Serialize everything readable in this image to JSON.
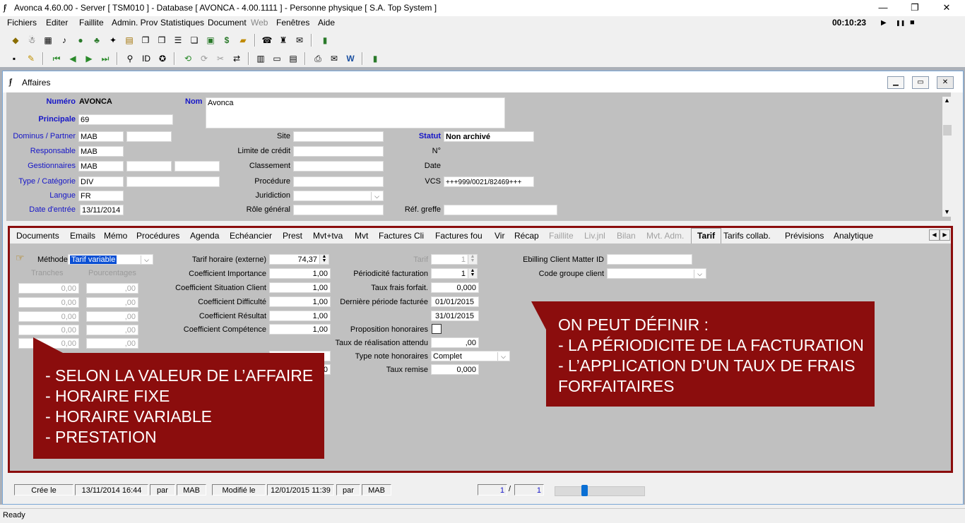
{
  "window": {
    "title": "Avonca 4.60.00 - Server [ TSM010 ] - Database [ AVONCA - 4.00.1111 ] - Personne physique [ S.A. Top System ]",
    "minimize": "—",
    "restore": "❐",
    "close": "✕"
  },
  "menu": [
    "Fichiers",
    "Editer",
    "Faillite",
    "Admin. Prov",
    "Statistiques",
    "Document",
    "Web",
    "Fenêtres",
    "Aide"
  ],
  "timer": {
    "value": "00:10:23",
    "play": "▶",
    "pause": "❚❚",
    "stop": "■"
  },
  "child": {
    "title": "Affaires",
    "min": "▁",
    "max": "▭",
    "close": "✕"
  },
  "fields": {
    "numero_label": "Numéro",
    "numero": "AVONCA",
    "nom_label": "Nom",
    "nom": "Avonca",
    "principale_label": "Principale",
    "principale": "69",
    "dominus_label": "Dominus / Partner",
    "dominus": "MAB",
    "responsable_label": "Responsable",
    "responsable": "MAB",
    "gestionnaires_label": "Gestionnaires",
    "gestionnaires": "MAB",
    "type_label": "Type / Catégorie",
    "type": "DIV",
    "langue_label": "Langue",
    "langue": "FR",
    "date_entree_label": "Date d'entrée",
    "date_entree": "13/11/2014",
    "site_label": "Site",
    "limite_label": "Limite de crédit",
    "classement_label": "Classement",
    "procedure_label": "Procédure",
    "juridiction_label": "Juridiction",
    "role_label": "Rôle général",
    "statut_label": "Statut",
    "statut": "Non archivé",
    "no_label": "N°",
    "date_label": "Date",
    "vcs_label": "VCS",
    "vcs": "+++999/0021/82469+++",
    "ref_label": "Réf. greffe"
  },
  "tabs": [
    {
      "label": "Documents",
      "state": "normal"
    },
    {
      "label": "Emails",
      "state": "normal"
    },
    {
      "label": "Mémo",
      "state": "normal"
    },
    {
      "label": "Procédures",
      "state": "normal"
    },
    {
      "label": "Agenda",
      "state": "normal"
    },
    {
      "label": "Echéancier",
      "state": "normal"
    },
    {
      "label": "Prest",
      "state": "normal"
    },
    {
      "label": "Mvt+tva",
      "state": "normal"
    },
    {
      "label": "Mvt",
      "state": "normal"
    },
    {
      "label": "Factures Cli",
      "state": "normal"
    },
    {
      "label": "Factures fou",
      "state": "normal"
    },
    {
      "label": "Vir",
      "state": "normal"
    },
    {
      "label": "Récap",
      "state": "normal"
    },
    {
      "label": "Faillite",
      "state": "disabled"
    },
    {
      "label": "Liv.jnl",
      "state": "disabled"
    },
    {
      "label": "Bilan",
      "state": "disabled"
    },
    {
      "label": "Mvt. Adm.",
      "state": "disabled"
    },
    {
      "label": "Tarif",
      "state": "active"
    },
    {
      "label": "Tarifs collab.",
      "state": "normal"
    },
    {
      "label": "Prévisions",
      "state": "normal"
    },
    {
      "label": "Analytique",
      "state": "normal"
    }
  ],
  "tarif": {
    "methode_label": "Méthode",
    "methode": "Tarif variable",
    "tranches_label": "Tranches",
    "pourcentages_label": "Pourcentages",
    "zero_val": "0,00",
    "zero_pct": ",00",
    "tarif_horaire_label": "Tarif horaire (externe)",
    "tarif_horaire": "74,37",
    "coef_importance_label": "Coefficient Importance",
    "coef_importance": "1,00",
    "coef_situation_label": "Coefficient Situation Client",
    "coef_situation": "1,00",
    "coef_difficulte_label": "Coefficient Difficulté",
    "coef_difficulte": "1,00",
    "coef_resultat_label": "Coefficient Résultat",
    "coef_resultat": "1,00",
    "coef_competence_label": "Coefficient Compétence",
    "coef_competence": "1,00",
    "partial_zero": "0",
    "tarif_label": "Tarif",
    "tarif": "1",
    "periodicite_label": "Périodicité facturation",
    "periodicite": "1",
    "taux_frais_label": "Taux frais forfait.",
    "taux_frais": "0,000",
    "derniere_periode_label": "Dernière période facturée",
    "derniere_debut": "01/01/2015",
    "derniere_fin": "31/01/2015",
    "proposition_label": "Proposition honoraires",
    "taux_realisation_label": "Taux de réalisation attendu",
    "taux_realisation": ",00",
    "type_note_label": "Type note honoraires",
    "type_note": "Complet",
    "taux_remise_label": "Taux remise",
    "taux_remise": "0,000",
    "ebilling_label": "Ebilling Client Matter ID",
    "code_groupe_label": "Code groupe client"
  },
  "callouts": {
    "left": [
      "- SELON LA VALEUR DE L’AFFAIRE",
      "- HORAIRE FIXE",
      "- HORAIRE VARIABLE",
      "- PRESTATION"
    ],
    "right": [
      "ON PEUT DÉFINIR :",
      "- LA PÉRIODICITE DE LA FACTURATION",
      "- L’APPLICATION D’UN TAUX DE FRAIS FORFAITAIRES"
    ]
  },
  "status": {
    "cree_label": "Crée le",
    "cree": "13/11/2014 16:44",
    "par": "par",
    "cree_user": "MAB",
    "modifie_label": "Modifié le",
    "modifie": "12/01/2015 11:39",
    "modifie_user": "MAB",
    "page": "1",
    "slash": "/",
    "total": "1",
    "ready": "Ready"
  },
  "colors": {
    "callout": "#8b0d0d",
    "label_blue": "#1515c8"
  }
}
